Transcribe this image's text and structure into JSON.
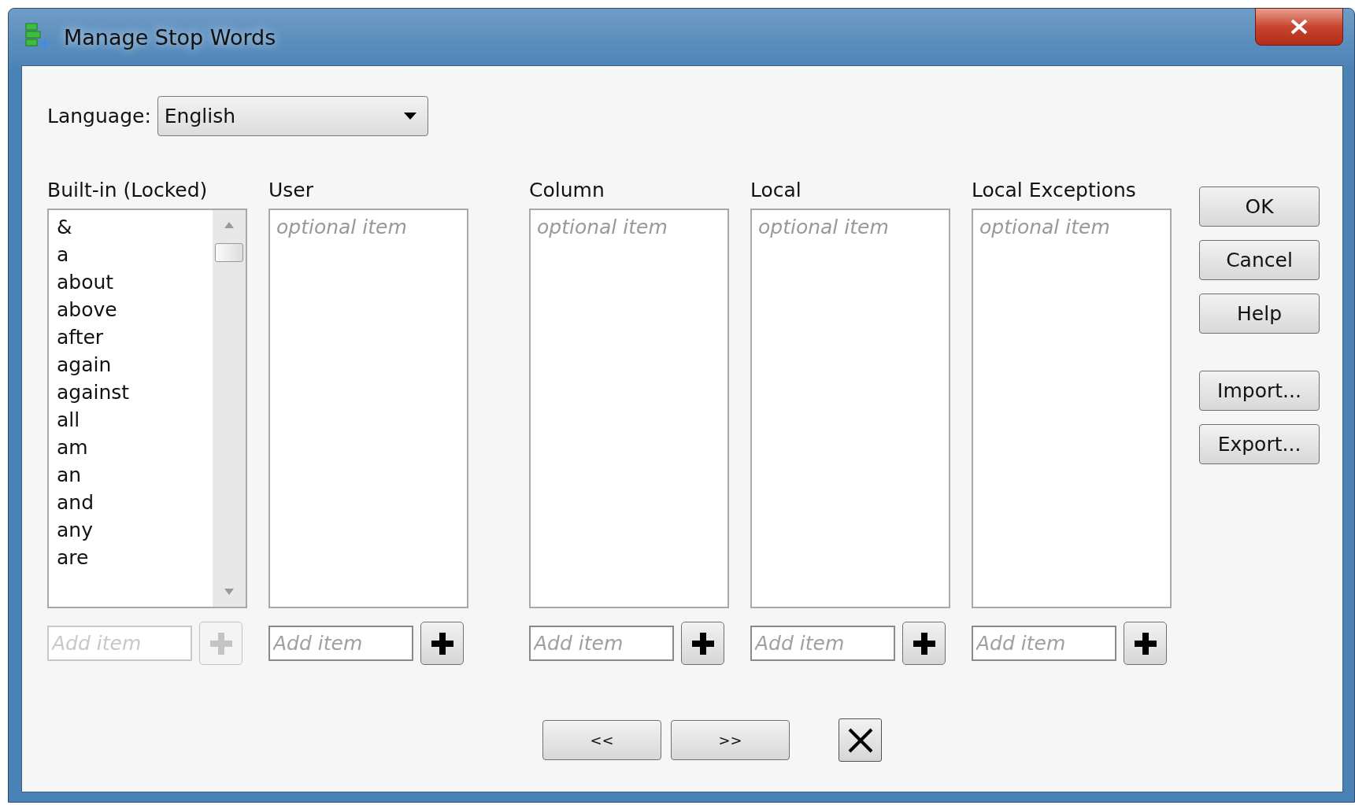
{
  "window": {
    "title": "Manage Stop Words"
  },
  "language": {
    "label": "Language:",
    "value": "English"
  },
  "lists": [
    {
      "title": "Built-in (Locked)",
      "items": [
        "&",
        "a",
        "about",
        "above",
        "after",
        "again",
        "against",
        "all",
        "am",
        "an",
        "and",
        "any",
        "are"
      ],
      "add_placeholder": "Add item",
      "disabled": true
    },
    {
      "title": "User",
      "placeholder": "optional item",
      "add_placeholder": "Add item",
      "disabled": false
    },
    {
      "title": "Column",
      "placeholder": "optional item",
      "add_placeholder": "Add item",
      "disabled": false
    },
    {
      "title": "Local",
      "placeholder": "optional item",
      "add_placeholder": "Add item",
      "disabled": false
    },
    {
      "title": "Local Exceptions",
      "placeholder": "optional item",
      "add_placeholder": "Add item",
      "disabled": false
    }
  ],
  "side_buttons": [
    [
      "OK",
      "Cancel",
      "Help"
    ],
    [
      "Import...",
      "Export..."
    ]
  ],
  "nav_buttons": [
    "<<",
    ">>"
  ]
}
